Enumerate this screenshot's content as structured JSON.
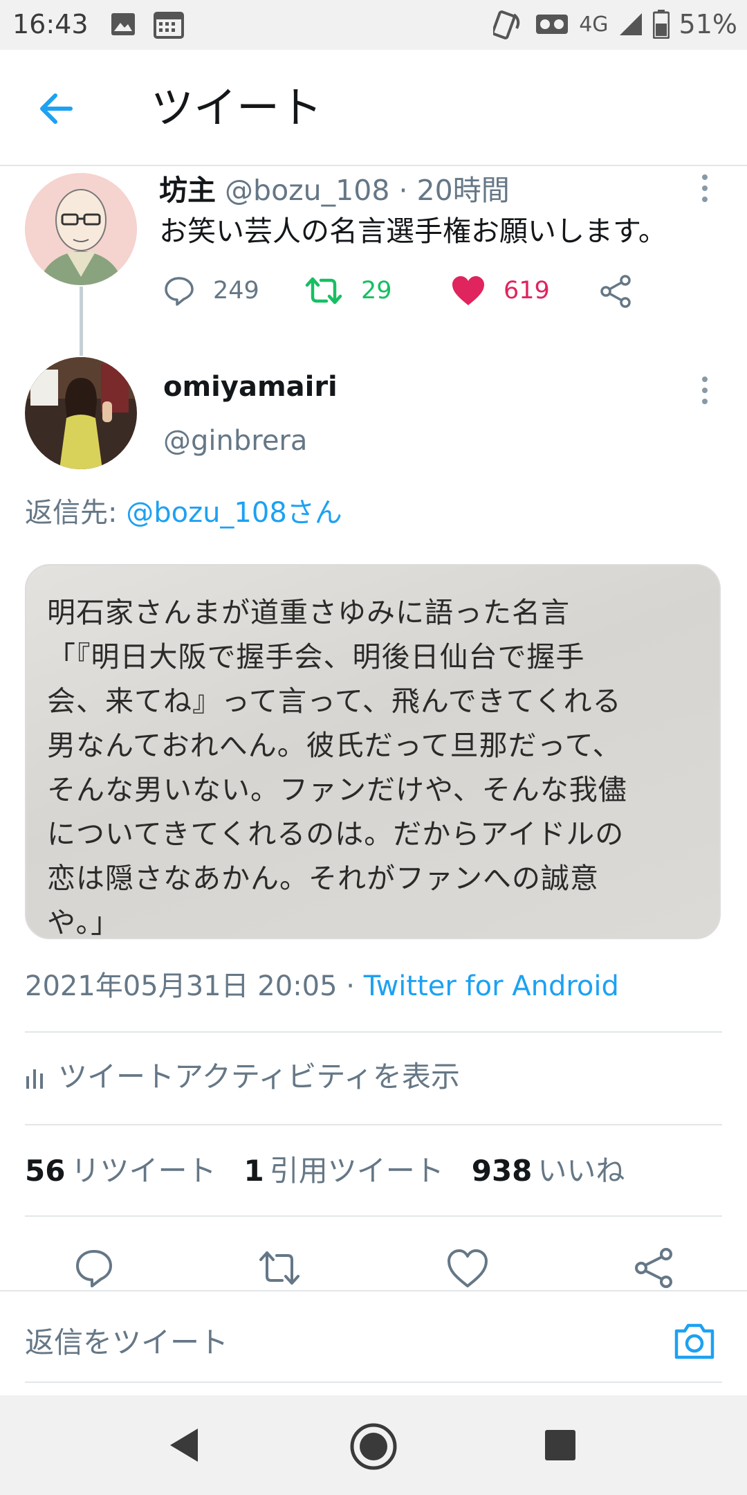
{
  "status_bar": {
    "time": "16:43",
    "network": "4G",
    "battery": "51%",
    "icons": [
      "image-icon",
      "calendar-icon",
      "nfc-icon",
      "voicemail-icon",
      "signal-icon",
      "battery-icon"
    ]
  },
  "header": {
    "title": "ツイート",
    "back_icon": "back-arrow-icon"
  },
  "parent_tweet": {
    "display_name": "坊主",
    "handle": "@bozu_108",
    "separator": " · ",
    "time_ago": "20時間",
    "text": "お笑い芸人の名言選手権お願いします。",
    "replies": "249",
    "retweets": "29",
    "likes": "619"
  },
  "reply_tweet": {
    "display_name": "omiyamairi",
    "handle": "@ginbrera",
    "reply_to_label": "返信先: ",
    "reply_to_handle": "@bozu_108さん",
    "image_text": "明石家さんまが道重さゆみに語った名言\n「『明日大阪で握手会、明後日仙台で握手\n会、来てね』って言って、飛んできてくれる\n男なんておれへん。彼氏だって旦那だって、\nそんな男いない。ファンだけや、そんな我儘\nについてきてくれるのは。だからアイドルの\n恋は隠さなあかん。それがファンへの誠意\nや。」",
    "timestamp": "2021年05月31日 20:05",
    "separator": " · ",
    "source": "Twitter for Android",
    "activity_label": "ツイートアクティビティを表示",
    "stats": {
      "retweets_count": "56",
      "retweets_label": "リツイート",
      "quotes_count": "1",
      "quotes_label": "引用ツイート",
      "likes_count": "938",
      "likes_label": "いいね"
    }
  },
  "compose": {
    "placeholder": "返信をツイート"
  },
  "colors": {
    "accent": "#1da1f2",
    "retweet_green": "#17bf63",
    "like_red": "#e0245e",
    "secondary_text": "#657786"
  }
}
